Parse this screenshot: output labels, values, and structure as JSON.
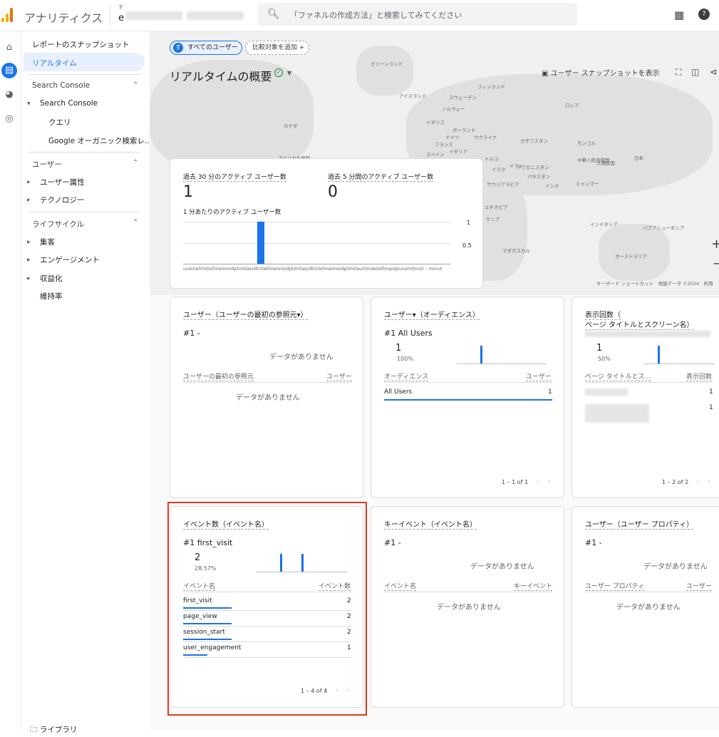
{
  "header": {
    "app_title": "アナリティクス",
    "account_small": "す",
    "account_initial": "e",
    "search_placeholder": "「ファネルの作成方法」と検索してみてください"
  },
  "sidebar": {
    "snapshot": "レポートのスナップショット",
    "realtime": "リアルタイム",
    "sec_search_console": "Search Console",
    "search_console": "Search Console",
    "query": "クエリ",
    "google_organic": "Google オーガニック検索レ...",
    "sec_user": "ユーザー",
    "user_attr": "ユーザー属性",
    "technology": "テクノロジー",
    "sec_lifecycle": "ライフサイクル",
    "acquisition": "集客",
    "engagement": "エンゲージメント",
    "monetization": "収益化",
    "retention": "維持率",
    "library": "ライブラリ"
  },
  "page": {
    "chip_all_users": "すべてのユーザー",
    "chip_avatar": "す",
    "chip_add_compare": "比較対象を追加",
    "title": "リアルタイムの概要",
    "snapshot_btn": "ユーザー スナップショットを表示",
    "map_footer": "キーボード ショートカット　地図データ ©2024　利用"
  },
  "map_labels": [
    "グリーンランド",
    "アイスランド",
    "スウェーデン",
    "フィンランド",
    "ノルウェー",
    "ロシア",
    "イギリス",
    "ポーランド",
    "ドイツ",
    "ウクライナ",
    "フランス",
    "イタリア",
    "スペイン",
    "カザフスタン",
    "モンゴル",
    "カナダ",
    "アメリカ合衆国",
    "トルコ",
    "イラク",
    "イラン",
    "アフガニスタン",
    "パキスタン",
    "中華人民共和国",
    "大韓民国",
    "日本",
    "インド",
    "サウジアラビア",
    "エチオピア",
    "ケニア",
    "マダガスカル",
    "インドネシア",
    "パプアニューギニア",
    "オーストラリア",
    "ミャンマー"
  ],
  "summary": {
    "active30_label": "過去 30 分のアクティブ ユーザー数",
    "active30_value": "1",
    "active5_label": "過去 5 分間のアクティブ ユーザー数",
    "active5_value": "0",
    "per_minute_label": "1 分あたりのアクティブ ユーザー数",
    "y_ticks": [
      "1",
      "0.5"
    ],
    "x_tick_text": "urantelrtntlefmeimoidptmitasrdtntlefmeimoidptmitasrdtntlefmeimoidptmitaurtmdeilefimpidpuramitnutr - minut"
  },
  "cards": {
    "referral": {
      "title": "ユーザー（ユーザーの最初の参照元▾）",
      "rank": "#1  -",
      "no_data": "データがありません",
      "col1": "ユーザーの最初の参照元",
      "col2": "ユーザー",
      "table_no_data": "データがありません"
    },
    "audience": {
      "title": "ユーザー▾（オーディエンス）",
      "rank": "#1  All Users",
      "value": "1",
      "pct": "100%",
      "col1": "オーディエンス",
      "col2": "ユーザー",
      "row_name": "All Users",
      "row_value": "1",
      "pagination": "1 – 1 of 1"
    },
    "views": {
      "title1": "表示回数（",
      "title2": "ページ タイトルとスクリーン名）",
      "value": "1",
      "pct": "50%",
      "col1": "ページ タイトルとス...",
      "col2": "表示回数",
      "row1_value": "1",
      "row2_value": "1",
      "pagination": "1 – 2 of 2"
    },
    "events": {
      "title": "イベント数（イベント名）",
      "rank": "#1  first_visit",
      "value": "2",
      "pct": "28.57%",
      "col1": "イベント名",
      "col2": "イベント数",
      "rows": [
        {
          "name": "first_visit",
          "value": "2",
          "share": 1.0
        },
        {
          "name": "page_view",
          "value": "2",
          "share": 1.0
        },
        {
          "name": "session_start",
          "value": "2",
          "share": 1.0
        },
        {
          "name": "user_engagement",
          "value": "1",
          "share": 0.5
        }
      ],
      "pagination": "1 – 4 of 4"
    },
    "key_events": {
      "title": "キーイベント（イベント名）",
      "rank": "#1  -",
      "no_data": "データがありません",
      "col1": "イベント名",
      "col2": "キーイベント",
      "table_no_data": "データがありません"
    },
    "user_props": {
      "title": "ユーザー（ユーザー プロパティ）",
      "rank": "#1  -",
      "no_data": "データがありません",
      "col1": "ユーザー プロパティ",
      "col2": "ユーザー",
      "table_no_data": "データがありません"
    }
  },
  "colors": {
    "accent": "#1a73e8",
    "highlight": "#e5391f",
    "success": "#188038"
  }
}
